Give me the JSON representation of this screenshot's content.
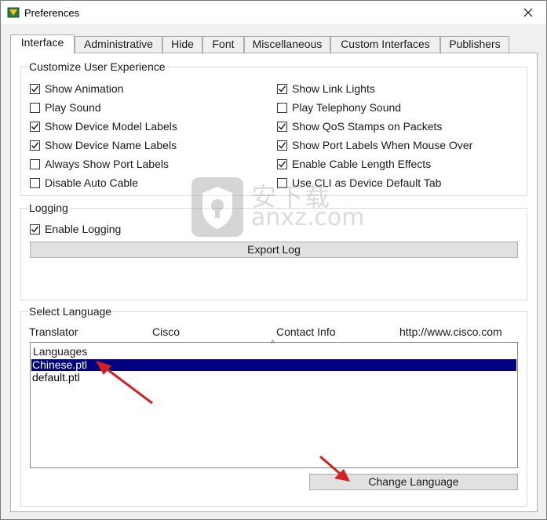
{
  "window": {
    "title": "Preferences"
  },
  "tabs": [
    {
      "label": "Interface",
      "active": true
    },
    {
      "label": "Administrative",
      "active": false
    },
    {
      "label": "Hide",
      "active": false
    },
    {
      "label": "Font",
      "active": false
    },
    {
      "label": "Miscellaneous",
      "active": false
    },
    {
      "label": "Custom Interfaces",
      "active": false
    },
    {
      "label": "Publishers",
      "active": false
    }
  ],
  "customize": {
    "title": "Customize User Experience",
    "left": [
      {
        "label": "Show Animation",
        "checked": true
      },
      {
        "label": "Play Sound",
        "checked": false
      },
      {
        "label": "Show Device Model Labels",
        "checked": true
      },
      {
        "label": "Show Device Name Labels",
        "checked": true
      },
      {
        "label": "Always Show Port Labels",
        "checked": false
      },
      {
        "label": "Disable Auto Cable",
        "checked": false
      }
    ],
    "right": [
      {
        "label": "Show Link Lights",
        "checked": true
      },
      {
        "label": "Play Telephony Sound",
        "checked": false
      },
      {
        "label": "Show QoS Stamps on Packets",
        "checked": true
      },
      {
        "label": "Show Port Labels When Mouse Over",
        "checked": true
      },
      {
        "label": "Enable Cable Length Effects",
        "checked": true
      },
      {
        "label": "Use CLI as Device Default Tab",
        "checked": false
      }
    ]
  },
  "logging": {
    "title": "Logging",
    "enable": {
      "label": "Enable Logging",
      "checked": true
    },
    "export_label": "Export Log"
  },
  "language": {
    "title": "Select Language",
    "translator_label": "Translator",
    "translator_value": "Cisco",
    "contact_label": "Contact Info",
    "contact_value": "http://www.cisco.com",
    "list_header": "Languages",
    "items": [
      {
        "label": "Chinese.ptl",
        "selected": true
      },
      {
        "label": "default.ptl",
        "selected": false
      }
    ],
    "change_label": "Change Language"
  },
  "watermark": {
    "cn": "安下载",
    "text": "anxz.com"
  },
  "colors": {
    "selection": "#000080",
    "arrow": "#d42020"
  }
}
